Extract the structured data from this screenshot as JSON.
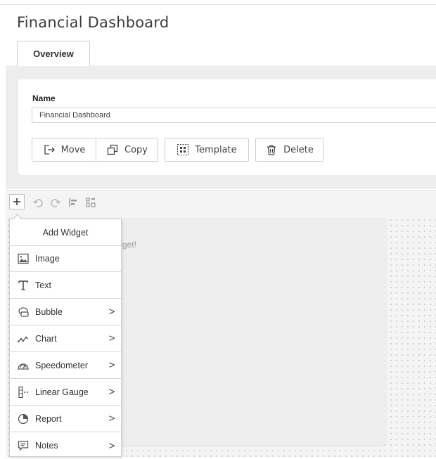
{
  "page": {
    "title": "Financial Dashboard"
  },
  "tabs": [
    {
      "label": "Overview",
      "active": true
    }
  ],
  "form": {
    "name_label": "Name",
    "name_value": "Financial Dashboard"
  },
  "actions": {
    "move": "Move",
    "copy": "Copy",
    "template": "Template",
    "delete": "Delete"
  },
  "toolbar": {
    "icons": [
      "add-icon",
      "undo-icon",
      "redo-icon",
      "align-icon",
      "layout-icon"
    ]
  },
  "canvas": {
    "hint": "widget!"
  },
  "widget_menu": {
    "title": "Add Widget",
    "items": [
      {
        "label": "Image",
        "icon": "image-icon",
        "submenu": false,
        "arrow": ""
      },
      {
        "label": "Text",
        "icon": "text-icon",
        "submenu": false,
        "arrow": ""
      },
      {
        "label": "Bubble",
        "icon": "bubble-icon",
        "submenu": true,
        "arrow": ">"
      },
      {
        "label": "Chart",
        "icon": "chart-icon",
        "submenu": true,
        "arrow": ">"
      },
      {
        "label": "Speedometer",
        "icon": "speedometer-icon",
        "submenu": true,
        "arrow": ">"
      },
      {
        "label": "Linear Gauge",
        "icon": "linear-gauge-icon",
        "submenu": true,
        "arrow": ">"
      },
      {
        "label": "Report",
        "icon": "report-icon",
        "submenu": true,
        "arrow": ">"
      },
      {
        "label": "Notes",
        "icon": "notes-icon",
        "submenu": true,
        "arrow": ">"
      }
    ]
  },
  "colors": {
    "background": "#ffffff",
    "panel": "#ededed",
    "border": "#cfcfcf",
    "text": "#333333"
  }
}
